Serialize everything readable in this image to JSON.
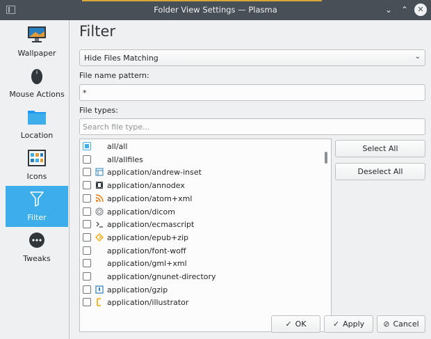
{
  "window": {
    "title": "Folder View Settings — Plasma",
    "minimize_glyph": "⌄",
    "maximize_glyph": "⌃",
    "close_glyph": "✕"
  },
  "sidebar": {
    "items": [
      {
        "label": "Wallpaper",
        "icon": "monitor-icon"
      },
      {
        "label": "Mouse Actions",
        "icon": "mouse-icon"
      },
      {
        "label": "Location",
        "icon": "folder-icon"
      },
      {
        "label": "Icons",
        "icon": "icons-grid-icon"
      },
      {
        "label": "Filter",
        "icon": "funnel-icon",
        "active": true
      },
      {
        "label": "Tweaks",
        "icon": "more-dots-icon"
      }
    ]
  },
  "filter": {
    "title": "Filter",
    "mode_selected": "Hide Files Matching",
    "pattern_label": "File name pattern:",
    "pattern_value": "*",
    "types_label": "File types:",
    "search_placeholder": "Search file type...",
    "file_types": [
      {
        "name": "all/all",
        "icon": "",
        "state": "partial"
      },
      {
        "name": "all/allfiles",
        "icon": "",
        "state": "unchecked"
      },
      {
        "name": "application/andrew-inset",
        "icon": "document-layout-icon",
        "state": "unchecked"
      },
      {
        "name": "application/annodex",
        "icon": "film-icon",
        "state": "unchecked"
      },
      {
        "name": "application/atom+xml",
        "icon": "rss-feed-icon",
        "state": "unchecked"
      },
      {
        "name": "application/dicom",
        "icon": "dicom-icon",
        "state": "unchecked"
      },
      {
        "name": "application/ecmascript",
        "icon": "terminal-prompt-icon",
        "state": "unchecked"
      },
      {
        "name": "application/epub+zip",
        "icon": "epub-icon",
        "state": "unchecked"
      },
      {
        "name": "application/font-woff",
        "icon": "",
        "state": "unchecked"
      },
      {
        "name": "application/gml+xml",
        "icon": "",
        "state": "unchecked"
      },
      {
        "name": "application/gnunet-directory",
        "icon": "",
        "state": "unchecked"
      },
      {
        "name": "application/gzip",
        "icon": "archive-icon",
        "state": "unchecked"
      },
      {
        "name": "application/illustrator",
        "icon": "illustrator-icon",
        "state": "unchecked"
      }
    ],
    "select_all_label": "Select All",
    "deselect_all_label": "Deselect All"
  },
  "footer": {
    "ok_label": "OK",
    "apply_label": "Apply",
    "cancel_label": "Cancel"
  },
  "colors": {
    "accent": "#3daee9",
    "titlebar": "#475057",
    "window_bg": "#eff0f1"
  }
}
